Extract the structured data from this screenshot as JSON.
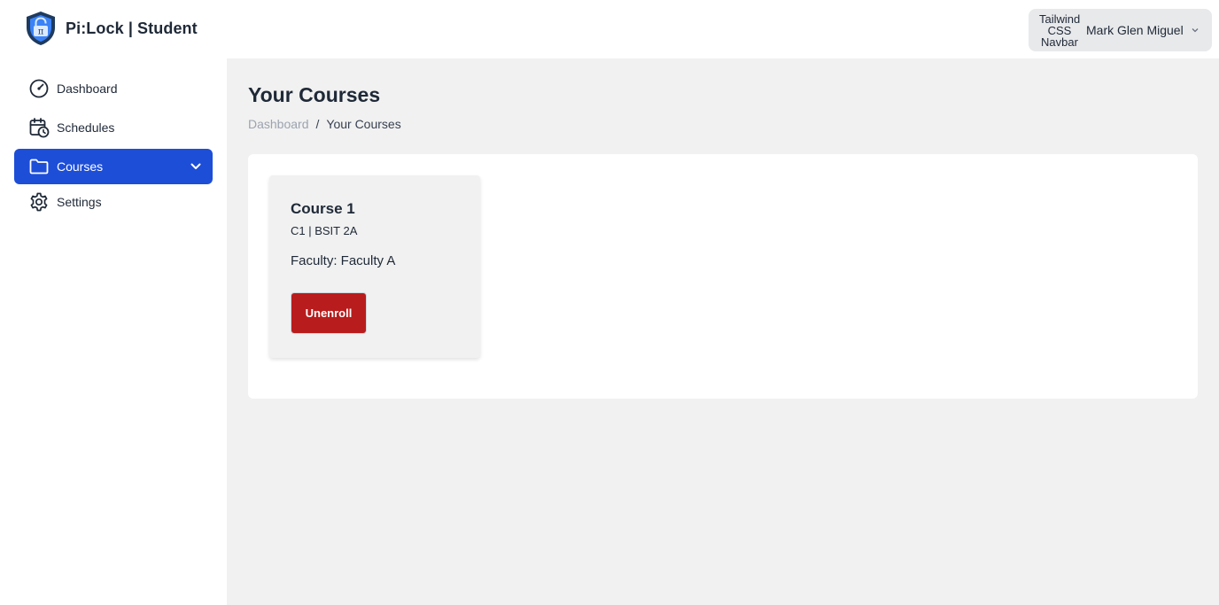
{
  "app": {
    "brand_title": "Pi:Lock | Student"
  },
  "user_menu": {
    "avatar_alt_lines": [
      "Tailwind",
      "CSS",
      "Navbar"
    ],
    "name": "Mark Glen Miguel"
  },
  "sidebar": {
    "items": [
      {
        "label": "Dashboard",
        "icon": "speedometer-icon",
        "active": false
      },
      {
        "label": "Schedules",
        "icon": "calendar-clock-icon",
        "active": false
      },
      {
        "label": "Courses",
        "icon": "folder-icon",
        "active": true
      },
      {
        "label": "Settings",
        "icon": "gear-icon",
        "active": false
      }
    ]
  },
  "main": {
    "title": "Your Courses",
    "breadcrumb": {
      "link": "Dashboard",
      "separator": "/",
      "current": "Your Courses"
    },
    "courses": [
      {
        "name": "Course 1",
        "meta": "C1 | BSIT 2A",
        "faculty": "Faculty: Faculty A",
        "action_label": "Unenroll"
      }
    ]
  },
  "colors": {
    "primary": "#1d4ed8",
    "danger": "#b91c1c",
    "content_bg": "#f1f1f1",
    "text": "#1f2937"
  }
}
